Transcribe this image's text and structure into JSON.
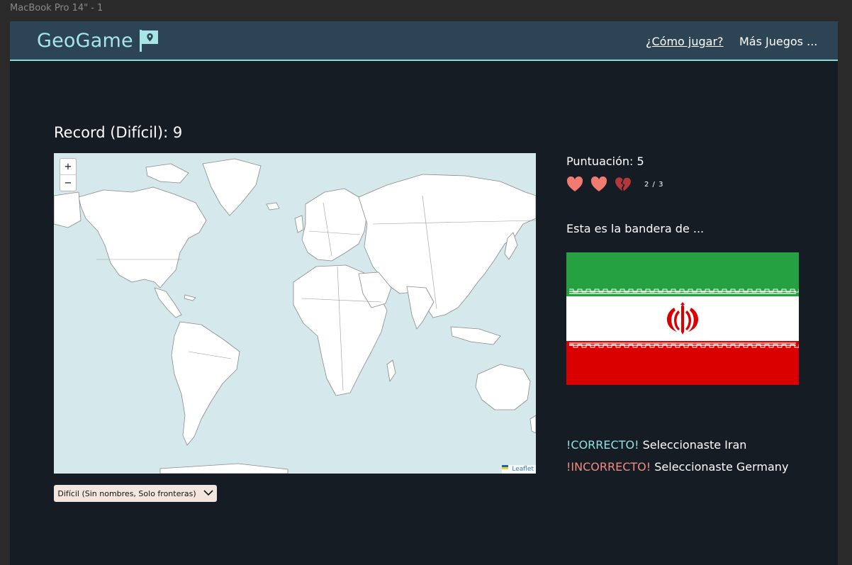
{
  "frame_label": "MacBook Pro 14\" - 1",
  "header": {
    "logo_text": "GeoGame",
    "logo_icon": "flag-pin-icon",
    "nav_how_to_play": "¿Cómo jugar?",
    "nav_more_games": "Más Juegos ..."
  },
  "record": "Record (Difícil): 9",
  "map": {
    "zoom_in": "+",
    "zoom_out": "−",
    "attribution": "Leaflet"
  },
  "difficulty_select": {
    "selected": "Difícil (Sin nombres, Solo fronteras)"
  },
  "game": {
    "score": "Puntuación: 5",
    "lives": [
      "full",
      "full",
      "broken"
    ],
    "lives_text": "2 / 3",
    "prompt": "Esta es la bandera de ...",
    "flag_icon": "iran-flag"
  },
  "results": [
    {
      "status": "!CORRECTO!",
      "message": "Seleccionaste Iran"
    },
    {
      "status": "!INCORRECTO!",
      "message": "Seleccionaste Germany"
    }
  ],
  "colors": {
    "accent": "#8fd8d8",
    "header_bg": "#2d4455",
    "app_bg": "#161c24",
    "correct": "#8fe0e0",
    "incorrect": "#f08a82",
    "heart": "#ef7b71",
    "heart_broken": "#b1383b"
  }
}
